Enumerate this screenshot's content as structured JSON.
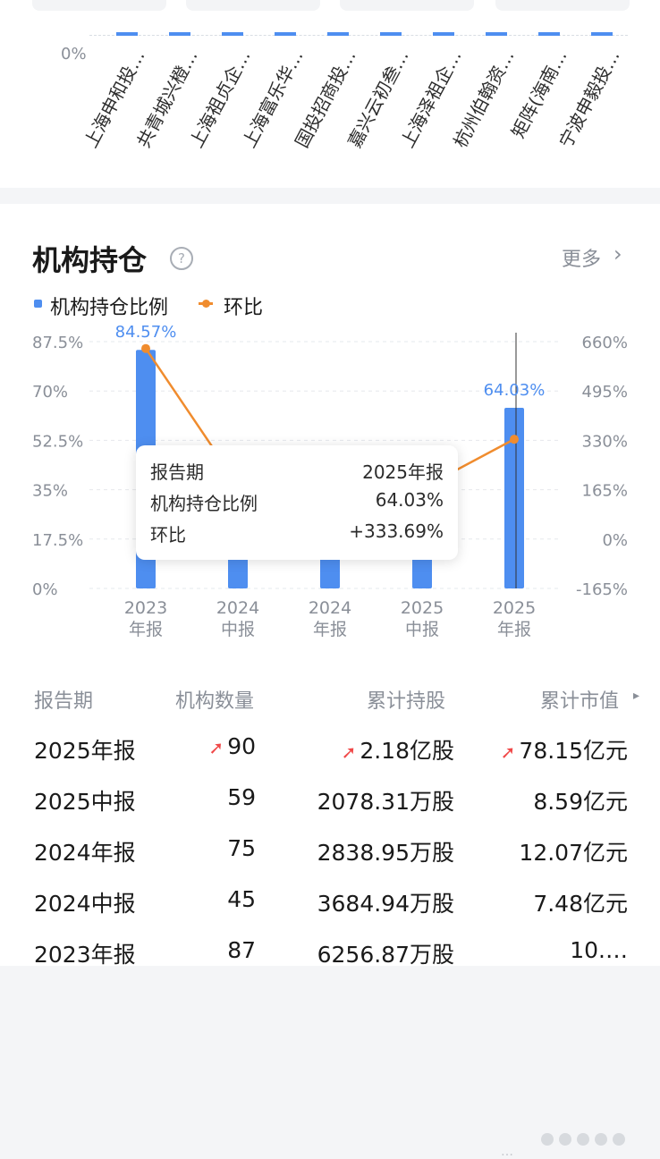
{
  "top_chart": {
    "y_label": "0%",
    "categories": [
      "上海申和投…",
      "共青城兴橙…",
      "上海祖贞企…",
      "上海富乐华…",
      "国投招商投…",
      "嘉兴云初叁…",
      "上海泽祖企…",
      "杭州伯翰资…",
      "矩阵(海南…",
      "宁波申毅投…"
    ]
  },
  "section": {
    "title": "机构持仓",
    "help_icon": "question-circle-icon",
    "more_label": "更多",
    "more_icon": "chevron-right-icon"
  },
  "legend": {
    "bar_label": "机构持仓比例",
    "line_label": "环比"
  },
  "chart_data": {
    "type": "bar",
    "categories": [
      "2023\n年报",
      "2024\n中报",
      "2024\n年报",
      "2025\n中报",
      "2025\n年报"
    ],
    "series": [
      {
        "name": "机构持仓比例",
        "type": "bar",
        "axis": "left",
        "unit": "%",
        "values": [
          84.57,
          13.0,
          16.5,
          14.77,
          64.03
        ]
      },
      {
        "name": "环比",
        "type": "line",
        "axis": "right",
        "unit": "%",
        "values": [
          637.0,
          182.0,
          200.0,
          170.0,
          333.69
        ]
      }
    ],
    "left_axis": {
      "ticks": [
        "87.5%",
        "70%",
        "52.5%",
        "35%",
        "17.5%",
        "0%"
      ],
      "min": 0,
      "max": 87.5
    },
    "right_axis": {
      "ticks": [
        "660%",
        "495%",
        "330%",
        "165%",
        "0%",
        "-165%"
      ],
      "min": -165,
      "max": 660
    },
    "data_labels": [
      "84.57%",
      "64.03%"
    ],
    "grid": true,
    "colors": {
      "bar": "#4e8ef0",
      "line": "#f08c2e",
      "label": "#4e8ef0"
    }
  },
  "tooltip": {
    "rows": [
      {
        "k": "报告期",
        "v": "2025年报"
      },
      {
        "k": "机构持仓比例",
        "v": "64.03%"
      },
      {
        "k": "环比",
        "v": "+333.69%"
      }
    ]
  },
  "table": {
    "headers": [
      "报告期",
      "机构数量",
      "累计持股",
      "累计市值"
    ],
    "header_icon": "caret-right-icon",
    "up_icon": "red-up-arrow-icon",
    "rows": [
      {
        "period": "2025年报",
        "count": "90",
        "shares": "2.18亿股",
        "value": "78.15亿元"
      },
      {
        "period": "2025中报",
        "count": "59",
        "shares": "2078.31万股",
        "value": "8.59亿元"
      },
      {
        "period": "2024年报",
        "count": "75",
        "shares": "2838.95万股",
        "value": "12.07亿元"
      },
      {
        "period": "2024中报",
        "count": "45",
        "shares": "3684.94万股",
        "value": "7.48亿元"
      },
      {
        "period": "2023年报",
        "count": "87",
        "shares": "6256.87万股",
        "value": "10.…"
      }
    ]
  },
  "footer": {
    "watermark": "…"
  }
}
